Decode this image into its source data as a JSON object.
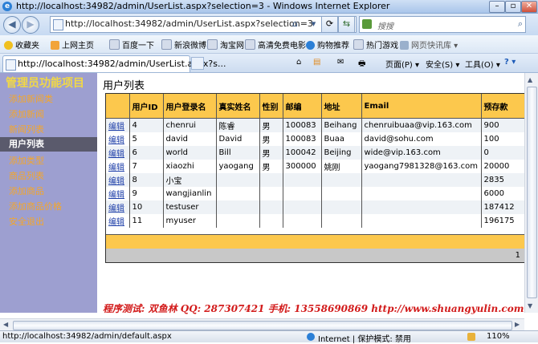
{
  "window": {
    "title": "http://localhost:34982/admin/UserList.aspx?selection=3 - Windows Internet Explorer",
    "logo": "e",
    "controls": [
      "–",
      "▫",
      "✕"
    ]
  },
  "nav": {
    "back_icon": "◀",
    "forward_icon": "▶",
    "address": "http://localhost:34982/admin/UserList.aspx?selection=3",
    "search_placeholder": "搜搜",
    "search_icon": "⌕",
    "buttons": [
      "▾",
      "⟳",
      "⇆",
      "✕"
    ]
  },
  "favbar": {
    "favorites_label": "收藏夹",
    "items": [
      "上网主页",
      "百度一下",
      "新浪微博",
      "淘宝网",
      "高清免费电影",
      "购物推荐",
      "热门游戏",
      "网页快讯库 ▾"
    ]
  },
  "tab": {
    "label": "http://localhost:34982/admin/UserList.aspx?s...",
    "close": "✕"
  },
  "commands": {
    "home": "⌂",
    "feeds": "▤",
    "mail": "✉",
    "print": "🖶",
    "page": "页面(P) ▾",
    "safety": "安全(S) ▾",
    "tools": "工具(O) ▾",
    "help": "? ▾"
  },
  "sidebar": {
    "title": "管理员功能项目",
    "items": [
      {
        "label": "添加新闻类",
        "active": false
      },
      {
        "label": "添加新闻",
        "active": false
      },
      {
        "label": "新闻列表",
        "active": false
      },
      {
        "label": "用户列表",
        "active": true
      },
      {
        "label": "添加类型",
        "active": false
      },
      {
        "label": "商品列表",
        "active": false
      },
      {
        "label": "添加商品",
        "active": false
      },
      {
        "label": "添加商品价格",
        "active": false
      },
      {
        "label": "安全退出",
        "active": false
      }
    ]
  },
  "page": {
    "title": "用户列表",
    "footer": "程序测试: 双鱼林   QQ: 287307421   手机: 13558690869   http://www.shuangyulin.com"
  },
  "table": {
    "headers": [
      "",
      "用户ID",
      "用户登录名",
      "真实姓名",
      "性别",
      "邮编",
      "地址",
      "Email",
      "预存款"
    ],
    "edit_label": "编辑",
    "rows": [
      [
        "4",
        "chenrui",
        "陈睿",
        "男",
        "100083",
        "Beihang",
        "chenruibuaa@vip.163.com",
        "900"
      ],
      [
        "5",
        "david",
        "David",
        "男",
        "100083",
        "Buaa",
        "david@sohu.com",
        "100"
      ],
      [
        "6",
        "world",
        "Bill",
        "男",
        "100042",
        "Beijing",
        "wide@vip.163.com",
        "0"
      ],
      [
        "7",
        "xiaozhi",
        "yaogang",
        "男",
        "300000",
        "姚刚",
        "yaogang7981328@163.com",
        "20000"
      ],
      [
        "8",
        "小宝",
        "",
        "",
        "",
        "",
        "",
        "2835"
      ],
      [
        "9",
        "wangjianlin",
        "",
        "",
        "",
        "",
        "",
        "6000"
      ],
      [
        "10",
        "testuser",
        "",
        "",
        "",
        "",
        "",
        "187412"
      ],
      [
        "11",
        "myuser",
        "",
        "",
        "",
        "",
        "",
        "196175"
      ]
    ],
    "page_number": "1"
  },
  "status": {
    "url": "http://localhost:34982/admin/default.aspx",
    "zone": "Internet | 保护模式: 禁用",
    "zoom": "110%"
  }
}
